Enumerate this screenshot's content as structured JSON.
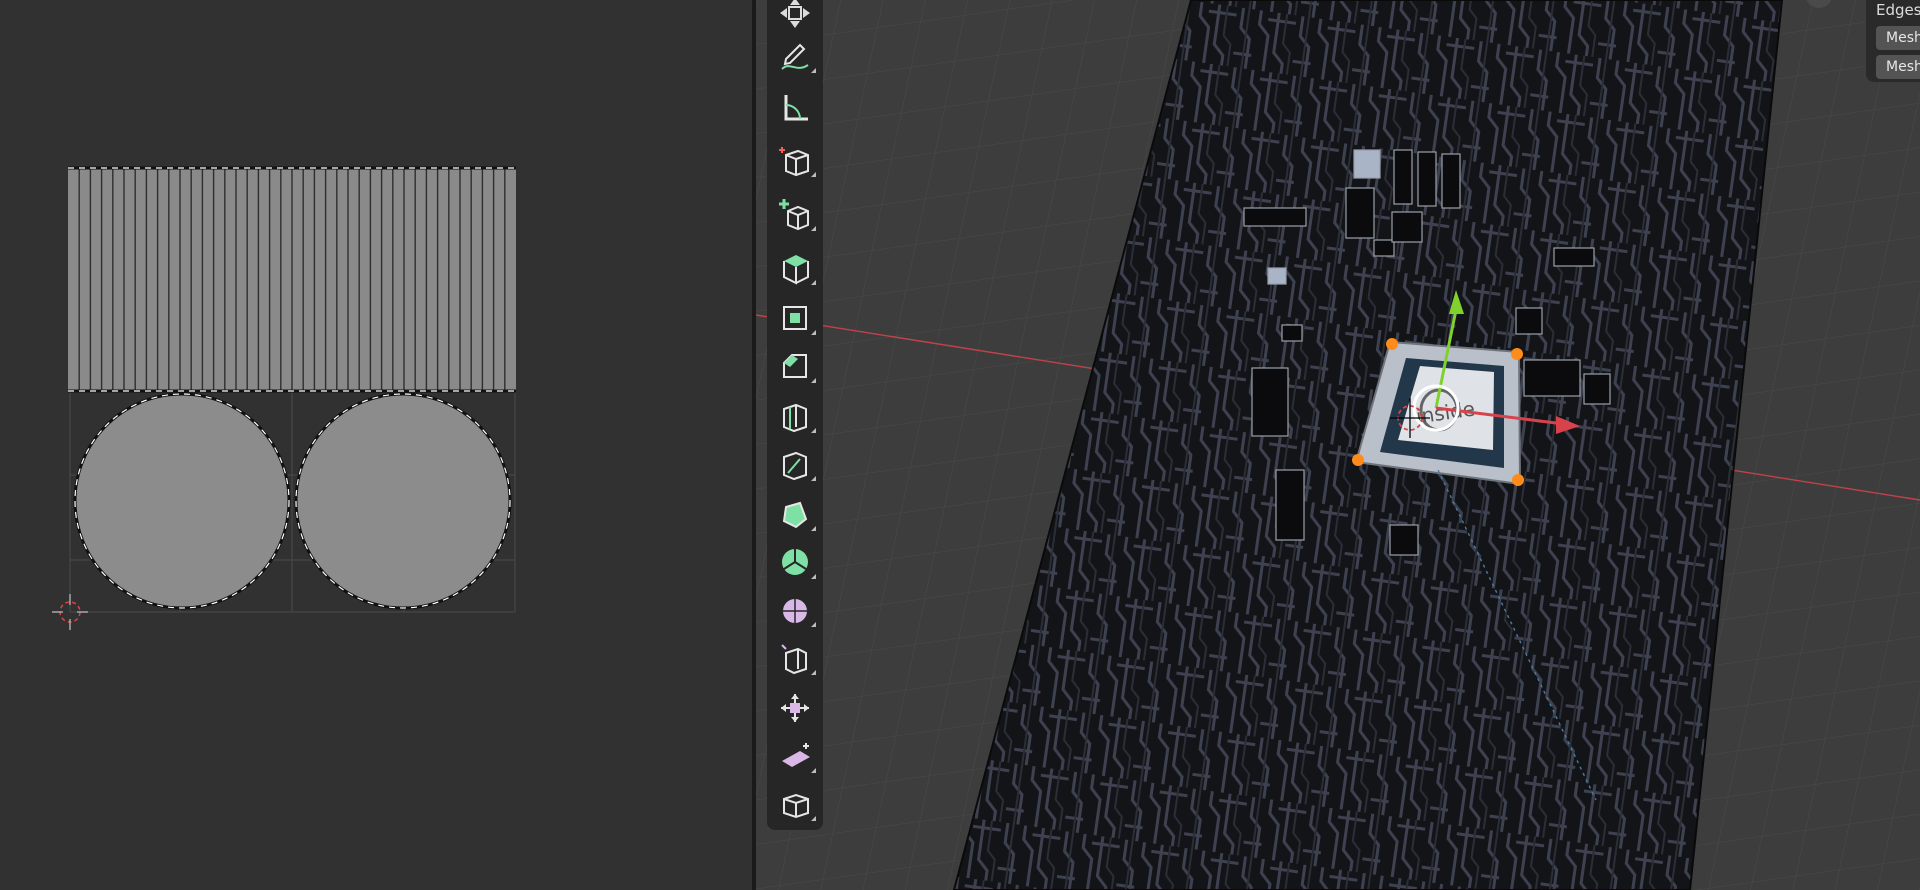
{
  "uv_editor": {
    "stripe_count": 40
  },
  "toolbar": {
    "tools": [
      {
        "name": "transform-icon"
      },
      {
        "name": "annotate-icon"
      },
      {
        "name": "measure-icon"
      },
      {
        "name": "add-cube-icon"
      },
      {
        "name": "add-primitive-icon"
      },
      {
        "name": "extrude-region-icon"
      },
      {
        "name": "inset-faces-icon"
      },
      {
        "name": "bevel-icon"
      },
      {
        "name": "loop-cut-icon"
      },
      {
        "name": "knife-icon"
      },
      {
        "name": "poly-build-icon"
      },
      {
        "name": "spin-icon"
      },
      {
        "name": "smooth-icon"
      },
      {
        "name": "edge-slide-icon"
      },
      {
        "name": "shrink-fatten-icon"
      },
      {
        "name": "shear-icon"
      },
      {
        "name": "rip-region-icon"
      }
    ]
  },
  "panel": {
    "label": "Edges",
    "buttons": [
      "Mesh",
      "Mesh"
    ]
  },
  "pcb_label": "inside",
  "colors": {
    "x_axis": "#d9424b",
    "y_axis": "#7fd12e",
    "selection": "#ff8c1a",
    "tool_accent": "#7fe0a6"
  }
}
